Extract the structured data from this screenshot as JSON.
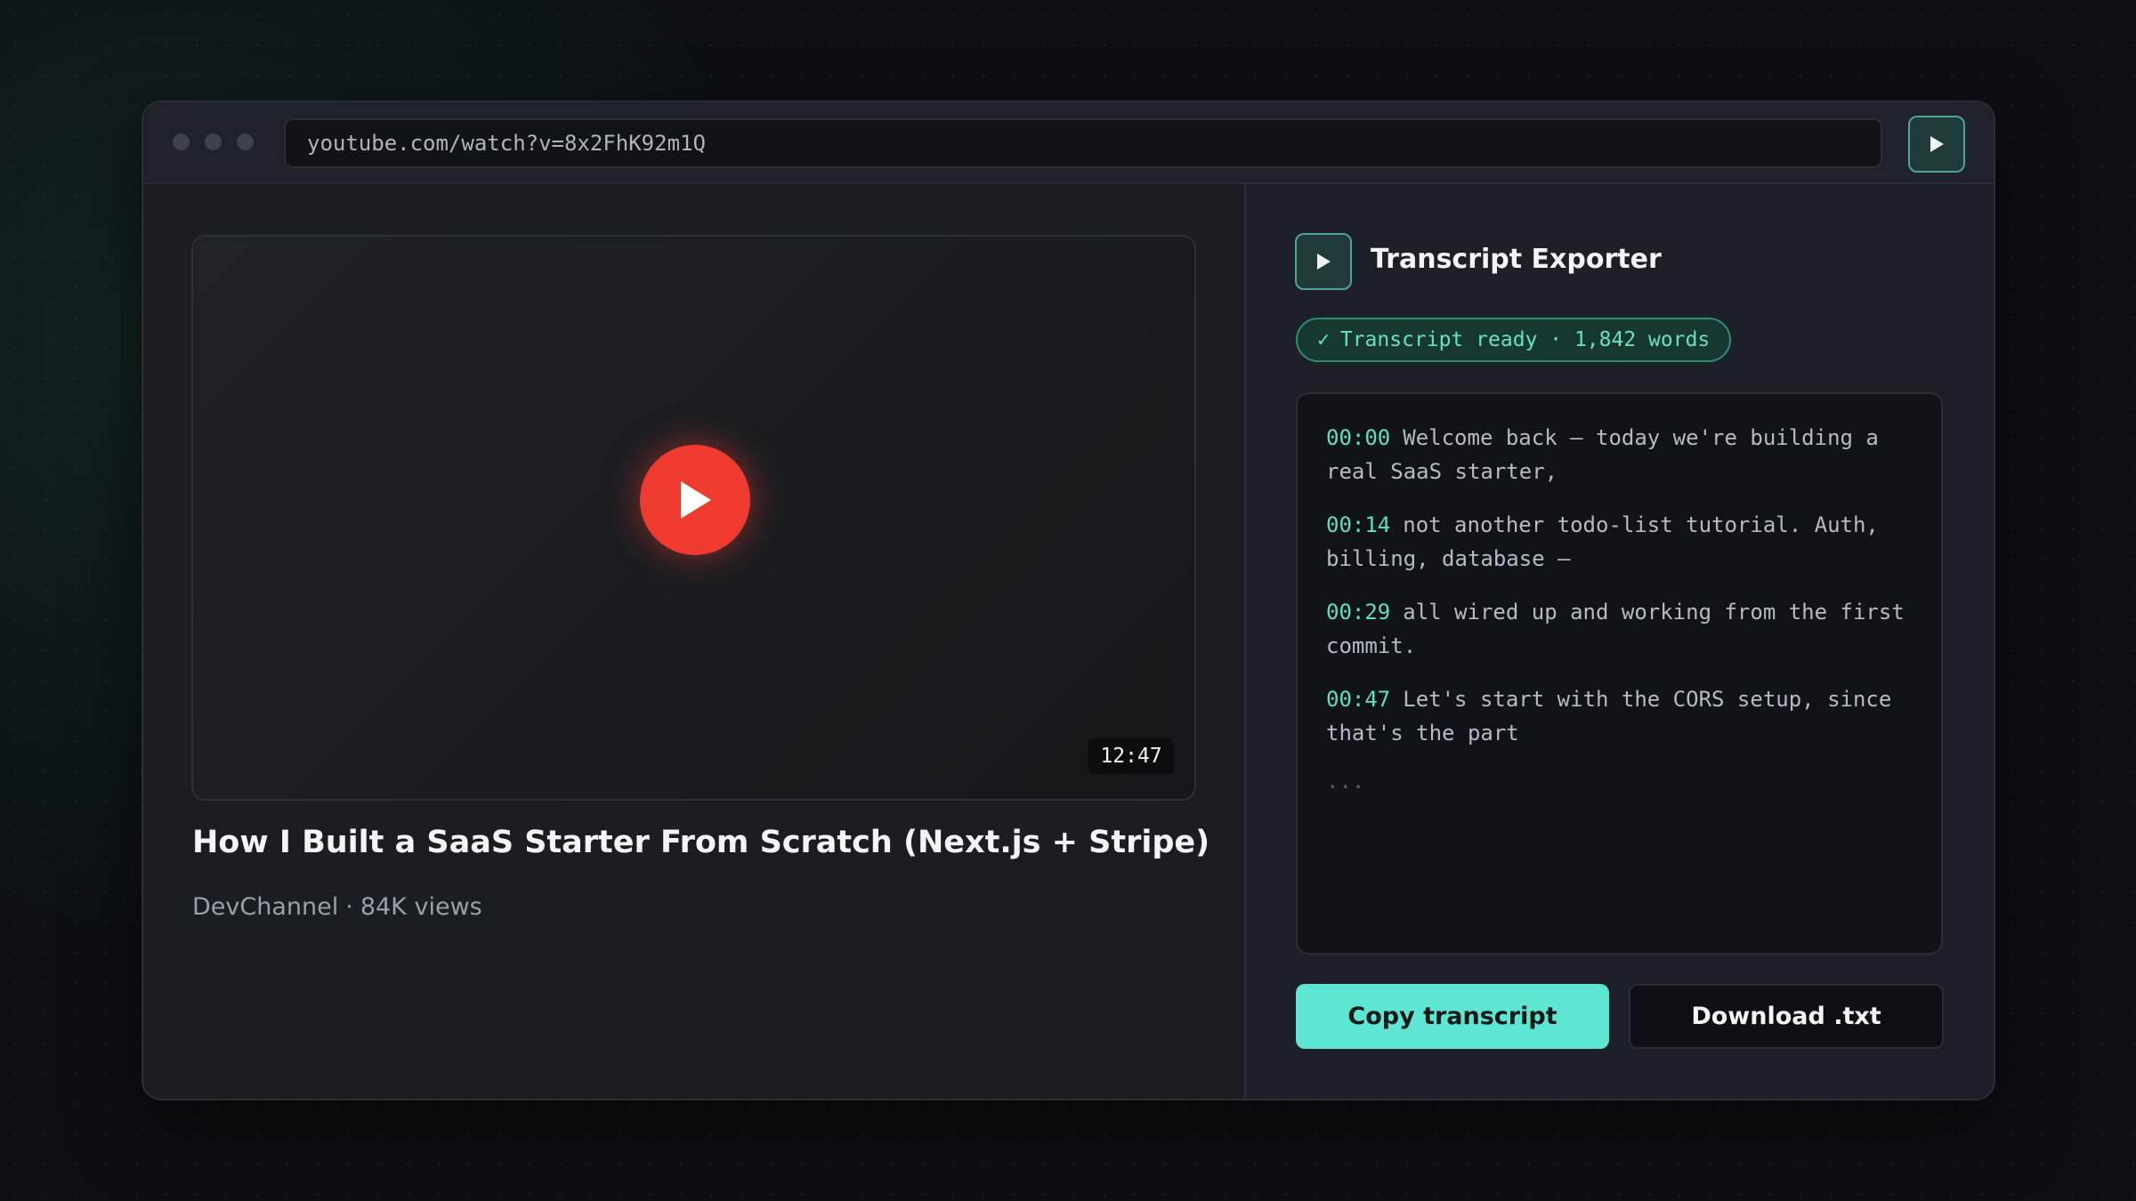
{
  "browser": {
    "url": "youtube.com/watch?v=8x2FhK92m1Q",
    "extension_icon": "play-icon"
  },
  "video": {
    "duration": "12:47",
    "title": "How I Built a SaaS Starter From Scratch (Next.js + Stripe)",
    "channel": "DevChannel",
    "separator": "·",
    "views": "84K views",
    "play_icon": "play-icon"
  },
  "extension": {
    "title": "Transcript Exporter",
    "status": {
      "check": "✓",
      "text": "Transcript ready · 1,842 words"
    },
    "transcript": [
      {
        "time": "00:00",
        "text": "Welcome back — today we're building a real SaaS starter,"
      },
      {
        "time": "00:14",
        "text": "not another todo-list tutorial. Auth, billing, database —"
      },
      {
        "time": "00:29",
        "text": "all wired up and working from the first commit."
      },
      {
        "time": "00:47",
        "text": "Let's start with the CORS setup, since that's the part"
      }
    ],
    "ellipsis": "...",
    "copy_label": "Copy transcript",
    "download_label": "Download .txt"
  },
  "colors": {
    "accent": "#5ee6d2",
    "timestamp": "#5fe0c0",
    "play_red": "#ef3b2f",
    "background": "#0c1014"
  }
}
